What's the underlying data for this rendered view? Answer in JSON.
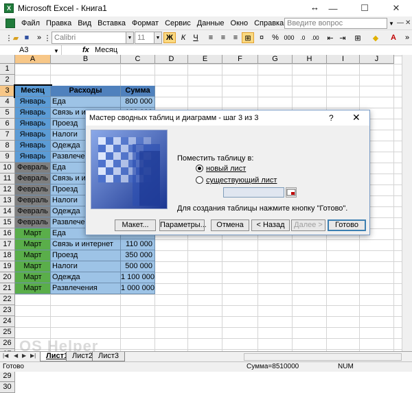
{
  "window": {
    "title": "Microsoft Excel - Книга1",
    "minimize": "—",
    "maximize": "☐",
    "close": "✕"
  },
  "menu": {
    "items": [
      "Файл",
      "Правка",
      "Вид",
      "Вставка",
      "Формат",
      "Сервис",
      "Данные",
      "Окно",
      "Справка"
    ],
    "help_placeholder": "Введите вопрос"
  },
  "toolbar": {
    "font": "Calibri",
    "size": "11",
    "bold": "Ж",
    "italic": "К",
    "underline": "Ч",
    "percent": "%",
    "thousands": "000"
  },
  "formula_bar": {
    "name_box": "A3",
    "fx": "fx",
    "value": "Месяц"
  },
  "grid": {
    "columns": [
      "A",
      "B",
      "C",
      "D",
      "E",
      "F",
      "G",
      "H",
      "I",
      "J"
    ],
    "rows": [
      "1",
      "2",
      "3",
      "4",
      "5",
      "6",
      "7",
      "8",
      "9",
      "10",
      "11",
      "12",
      "13",
      "14",
      "15",
      "16",
      "17",
      "18",
      "19",
      "20",
      "21",
      "22",
      "23",
      "24",
      "25",
      "26",
      "27",
      "28",
      "29",
      "30"
    ],
    "header": [
      "Месяц",
      "Расходы",
      "Сумма"
    ],
    "data": [
      [
        "Январь",
        "Еда",
        "800 000"
      ],
      [
        "Январь",
        "Связь и интернет",
        "100 000"
      ],
      [
        "Январь",
        "Проезд",
        ""
      ],
      [
        "Январь",
        "Налоги",
        ""
      ],
      [
        "Январь",
        "Одежда",
        ""
      ],
      [
        "Январь",
        "Развлечения",
        ""
      ],
      [
        "Февраль",
        "Еда",
        ""
      ],
      [
        "Февраль",
        "Связь и интернет",
        ""
      ],
      [
        "Февраль",
        "Проезд",
        ""
      ],
      [
        "Февраль",
        "Налоги",
        ""
      ],
      [
        "Февраль",
        "Одежда",
        ""
      ],
      [
        "Февраль",
        "Развлечения",
        ""
      ],
      [
        "Март",
        "Еда",
        ""
      ],
      [
        "Март",
        "Связь и интернет",
        "110 000"
      ],
      [
        "Март",
        "Проезд",
        "350 000"
      ],
      [
        "Март",
        "Налоги",
        "500 000"
      ],
      [
        "Март",
        "Одежда",
        "1 100 000"
      ],
      [
        "Март",
        "Развлечения",
        "1 000 000"
      ]
    ],
    "month_colors": {
      "Январь": "#5b9bd5",
      "Февраль": "#7f7f7f",
      "Март": "#5aae4a"
    },
    "header_color": "#4f81bd",
    "value_color": "#9dc3e6"
  },
  "sheets": [
    "Лист1",
    "Лист2",
    "Лист3"
  ],
  "status": {
    "ready": "Готово",
    "sum": "Сумма=8510000",
    "num": "NUM"
  },
  "dialog": {
    "title": "Мастер сводных таблиц и диаграмм - шаг 3 из 3",
    "help": "?",
    "close": "✕",
    "place_label": "Поместить таблицу в:",
    "option_new": "новый лист",
    "option_existing": "существующий лист",
    "hint": "Для создания таблицы нажмите кнопку \"Готово\".",
    "buttons": {
      "layout": "Макет...",
      "params": "Параметры...",
      "cancel": "Отмена",
      "back": "< Назад",
      "next": "Далее >",
      "finish": "Готово"
    }
  },
  "watermark": "OS Helper"
}
